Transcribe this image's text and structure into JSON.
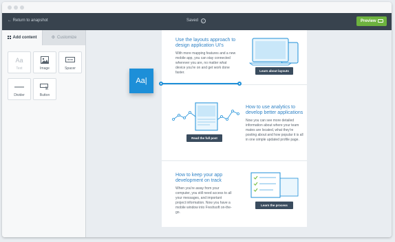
{
  "topbar": {
    "back_label": "← Return to anapshot",
    "saved_label": "Saved",
    "preview_label": "Preview"
  },
  "sidebar": {
    "tabs": [
      {
        "label": "Add content",
        "icon": "grid-icon"
      },
      {
        "label": "Customize",
        "icon": "gear-icon"
      }
    ],
    "items": [
      {
        "label": "Text",
        "icon": "text-icon",
        "glyph": "Aa",
        "disabled": true
      },
      {
        "label": "Image",
        "icon": "image-icon"
      },
      {
        "label": "Spacer",
        "icon": "spacer-icon"
      },
      {
        "label": "Divider",
        "icon": "divider-icon"
      },
      {
        "label": "Button",
        "icon": "button-icon"
      }
    ]
  },
  "dragging": {
    "glyph": "Aa|"
  },
  "sections": [
    {
      "title": "Use the layouts approach to design application UI's",
      "body": "With more mapping features and a new mobile app, you can stay connected wherever you are, no matter what device you're on and get work done faster.",
      "button": "Learn about layouts"
    },
    {
      "title": "How to use analytics to develop better applications",
      "body": "Now you can see more detailed information about where your team mates are located, what they're posting about and how popular it is all in one simple updated profile page.",
      "button": "Read the full post"
    },
    {
      "title": "How to keep your app development on track",
      "body": "When you're away from your computer, you still need access to all your messages, and important project information. Now you have a mobile window into Freshsoft on-the-go.",
      "button": "Learn the process"
    }
  ],
  "colors": {
    "accent": "#1d8fd8",
    "link": "#2f82c5",
    "topbar": "#38434e",
    "preview": "#6db33f",
    "button": "#3a4c5e",
    "check": "#7cc04a"
  }
}
